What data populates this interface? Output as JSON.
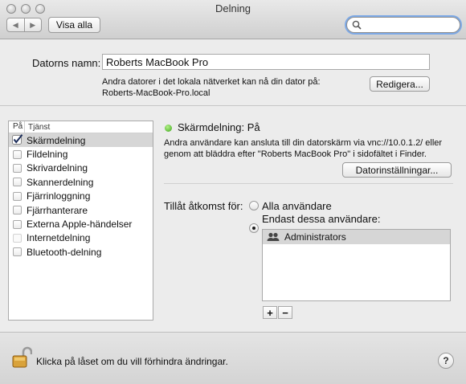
{
  "window": {
    "title": "Delning"
  },
  "toolbar": {
    "back_icon": "◀",
    "forward_icon": "▶",
    "show_all_label": "Visa alla",
    "search": {
      "value": "",
      "placeholder": ""
    }
  },
  "computer": {
    "name_label": "Datorns namn:",
    "name_value": "Roberts MacBook Pro",
    "info_line1": "Andra datorer i det lokala nätverket kan nå din dator på:",
    "info_line2": "Roberts-MacBook-Pro.local",
    "edit_label": "Redigera..."
  },
  "services": {
    "header_on": "På",
    "header_service": "Tjänst",
    "items": [
      {
        "label": "Skärmdelning",
        "checked": true,
        "selected": true,
        "enabled": true
      },
      {
        "label": "Fildelning",
        "checked": false,
        "selected": false,
        "enabled": true
      },
      {
        "label": "Skrivardelning",
        "checked": false,
        "selected": false,
        "enabled": true
      },
      {
        "label": "Skannerdelning",
        "checked": false,
        "selected": false,
        "enabled": true
      },
      {
        "label": "Fjärrinloggning",
        "checked": false,
        "selected": false,
        "enabled": true
      },
      {
        "label": "Fjärrhanterare",
        "checked": false,
        "selected": false,
        "enabled": true
      },
      {
        "label": "Externa Apple-händelser",
        "checked": false,
        "selected": false,
        "enabled": true
      },
      {
        "label": "Internetdelning",
        "checked": false,
        "selected": false,
        "enabled": false
      },
      {
        "label": "Bluetooth-delning",
        "checked": false,
        "selected": false,
        "enabled": true
      }
    ]
  },
  "detail": {
    "status": "Skärmdelning: På",
    "status_color": "#3aa51a",
    "desc_line1": "Andra användare kan ansluta till din datorskärm via vnc://10.0.1.2/ eller",
    "desc_line2": "genom att bläddra efter \"Roberts MacBook Pro\" i sidofältet i Finder.",
    "settings_button": "Datorinställningar...",
    "access_label": "Tillåt åtkomst för:",
    "radio_all": "Alla användare",
    "radio_only": "Endast dessa användare:",
    "users": [
      "Administrators"
    ],
    "add_label": "+",
    "remove_label": "−"
  },
  "footer": {
    "lock_text": "Klicka på låset om du vill förhindra ändringar.",
    "help_label": "?"
  }
}
